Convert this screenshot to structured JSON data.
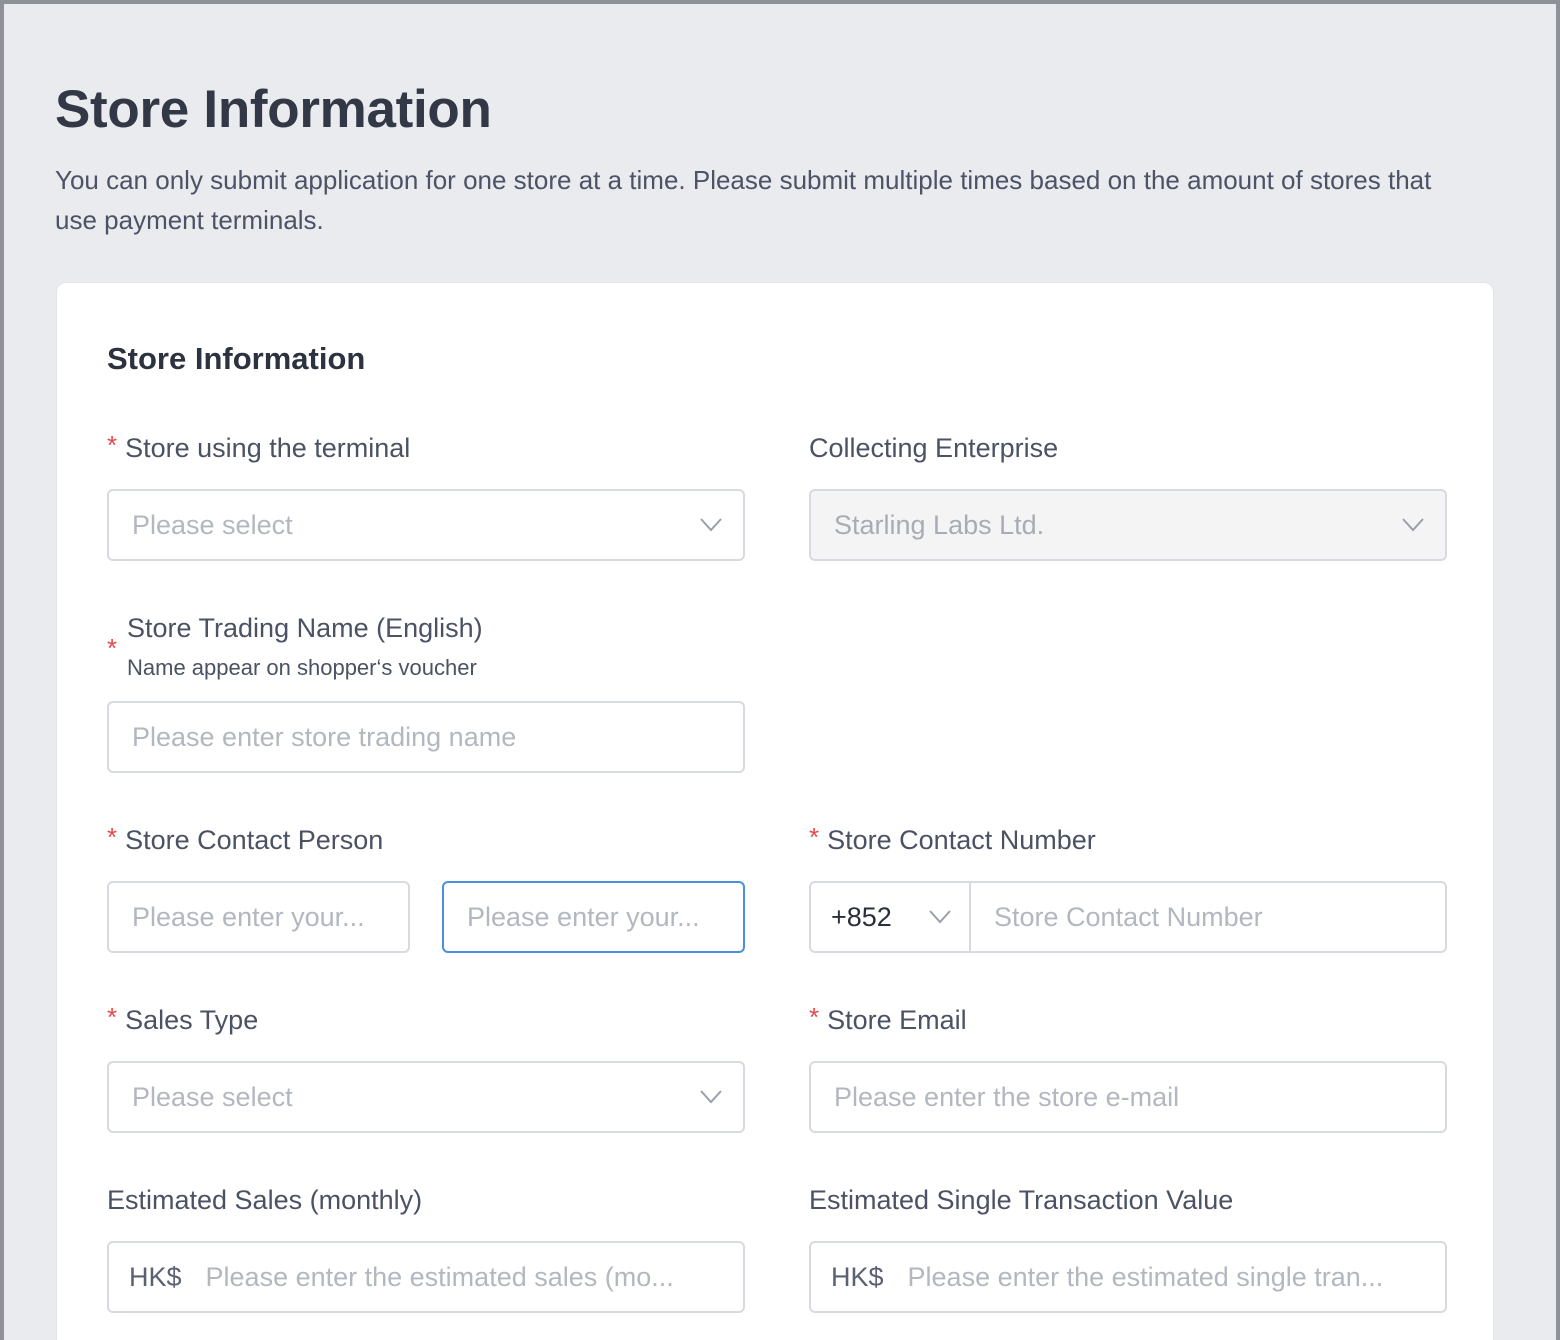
{
  "header": {
    "title": "Store Information",
    "description": "You can only submit application for one store at a time. Please submit multiple times based on the amount of stores that use payment terminals."
  },
  "card": {
    "title": "Store Information"
  },
  "fields": {
    "store_terminal": {
      "required": "*",
      "label": "Store using the terminal",
      "placeholder": "Please select"
    },
    "collecting_enterprise": {
      "label": "Collecting Enterprise",
      "value": "Starling Labs Ltd."
    },
    "trading_name": {
      "required": "*",
      "label": "Store Trading Name (English)",
      "sublabel": "Name appear on shopper‘s voucher",
      "placeholder": "Please enter store trading name"
    },
    "contact_person": {
      "required": "*",
      "label": "Store Contact Person",
      "first_placeholder": "Please enter your...",
      "last_placeholder": "Please enter your..."
    },
    "contact_number": {
      "required": "*",
      "label": "Store Contact Number",
      "country_code": "+852",
      "placeholder": "Store Contact Number"
    },
    "sales_type": {
      "required": "*",
      "label": "Sales Type",
      "placeholder": "Please select"
    },
    "store_email": {
      "required": "*",
      "label": "Store Email",
      "placeholder": "Please enter the store e-mail"
    },
    "estimated_sales": {
      "label": "Estimated Sales (monthly)",
      "currency": "HK$",
      "placeholder": "Please enter the estimated sales (mo..."
    },
    "estimated_single": {
      "label": "Estimated Single Transaction Value",
      "currency": "HK$",
      "placeholder": "Please enter the estimated single tran..."
    }
  },
  "colors": {
    "required": "#e5484d",
    "focus_border": "#4a90e2",
    "page_bg": "#eaebee"
  }
}
